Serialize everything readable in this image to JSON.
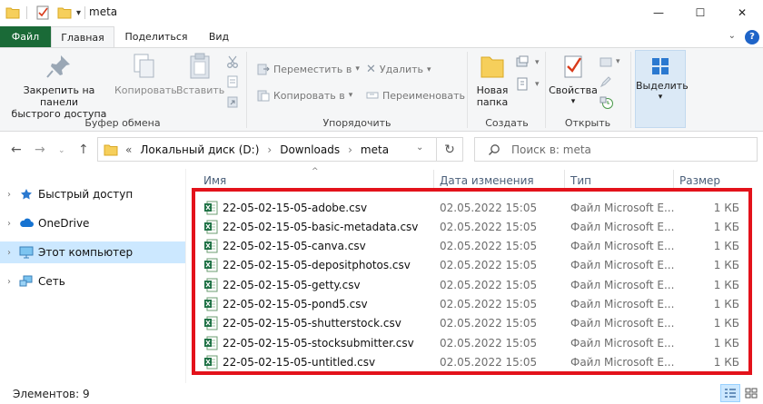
{
  "window": {
    "title": "meta",
    "minimize": "—",
    "maximize": "☐",
    "close": "✕"
  },
  "tabs": [
    {
      "label": "Файл"
    },
    {
      "label": "Главная"
    },
    {
      "label": "Поделиться"
    },
    {
      "label": "Вид"
    }
  ],
  "ribbon": {
    "clipboard": {
      "pin_label_1": "Закрепить на панели",
      "pin_label_2": "быстрого доступа",
      "copy": "Копировать",
      "paste": "Вставить",
      "group": "Буфер обмена"
    },
    "organize": {
      "move_to": "Переместить в",
      "copy_to": "Копировать в",
      "delete": "Удалить",
      "rename": "Переименовать",
      "group": "Упорядочить"
    },
    "new": {
      "new_folder_1": "Новая",
      "new_folder_2": "папка",
      "group": "Создать"
    },
    "open": {
      "properties": "Свойства",
      "group": "Открыть"
    },
    "select": {
      "select": "Выделить"
    }
  },
  "address": {
    "prefix": "«",
    "crumbs": [
      "Локальный диск (D:)",
      "Downloads",
      "meta"
    ],
    "separator": "›"
  },
  "search": {
    "placeholder": "Поиск в: meta"
  },
  "sidebar": {
    "items": [
      {
        "label": "Быстрый доступ",
        "icon": "star-icon"
      },
      {
        "label": "OneDrive",
        "icon": "cloud-icon"
      },
      {
        "label": "Этот компьютер",
        "icon": "computer-icon",
        "selected": true
      },
      {
        "label": "Сеть",
        "icon": "network-icon"
      }
    ]
  },
  "columns": {
    "name": "Имя",
    "date": "Дата изменения",
    "type": "Тип",
    "size": "Размер"
  },
  "files": [
    {
      "name": "22-05-02-15-05-adobe.csv",
      "date": "02.05.2022 15:05",
      "type": "Файл Microsoft E...",
      "size": "1 КБ"
    },
    {
      "name": "22-05-02-15-05-basic-metadata.csv",
      "date": "02.05.2022 15:05",
      "type": "Файл Microsoft E...",
      "size": "1 КБ"
    },
    {
      "name": "22-05-02-15-05-canva.csv",
      "date": "02.05.2022 15:05",
      "type": "Файл Microsoft E...",
      "size": "1 КБ"
    },
    {
      "name": "22-05-02-15-05-depositphotos.csv",
      "date": "02.05.2022 15:05",
      "type": "Файл Microsoft E...",
      "size": "1 КБ"
    },
    {
      "name": "22-05-02-15-05-getty.csv",
      "date": "02.05.2022 15:05",
      "type": "Файл Microsoft E...",
      "size": "1 КБ"
    },
    {
      "name": "22-05-02-15-05-pond5.csv",
      "date": "02.05.2022 15:05",
      "type": "Файл Microsoft E...",
      "size": "1 КБ"
    },
    {
      "name": "22-05-02-15-05-shutterstock.csv",
      "date": "02.05.2022 15:05",
      "type": "Файл Microsoft E...",
      "size": "1 КБ"
    },
    {
      "name": "22-05-02-15-05-stocksubmitter.csv",
      "date": "02.05.2022 15:05",
      "type": "Файл Microsoft E...",
      "size": "1 КБ"
    },
    {
      "name": "22-05-02-15-05-untitled.csv",
      "date": "02.05.2022 15:05",
      "type": "Файл Microsoft E...",
      "size": "1 КБ"
    }
  ],
  "status": {
    "count": "Элементов: 9"
  },
  "colors": {
    "file_tab": "#1a6a37",
    "selection": "#cce8ff",
    "highlight_border": "#e3121b"
  }
}
